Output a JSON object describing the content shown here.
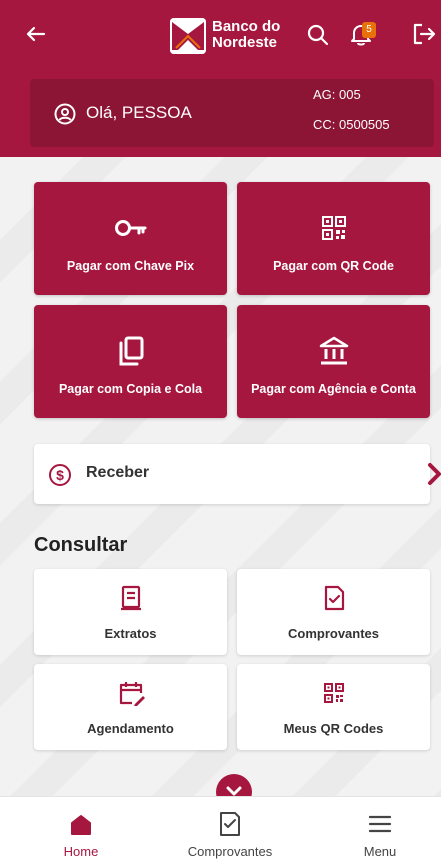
{
  "header": {
    "logo_line1": "Banco do",
    "logo_line2": "Nordeste",
    "notification_count": "5"
  },
  "account": {
    "greeting": "Olá, PESSOA",
    "agency": "AG: 005",
    "account": "CC: 0500505"
  },
  "pix_actions": [
    {
      "label": "Pagar com Chave Pix",
      "icon": "key-icon"
    },
    {
      "label": "Pagar com QR Code",
      "icon": "qr-code-icon"
    },
    {
      "label": "Pagar com Copia e Cola",
      "icon": "copy-icon"
    },
    {
      "label": "Pagar com Agência e Conta",
      "icon": "bank-icon"
    }
  ],
  "receive": {
    "label": "Receber",
    "icon": "dollar-circle-icon"
  },
  "consult": {
    "title": "Consultar",
    "items": [
      {
        "label": "Extratos",
        "icon": "statement-icon"
      },
      {
        "label": "Comprovantes",
        "icon": "receipt-check-icon"
      },
      {
        "label": "Agendamento",
        "icon": "calendar-edit-icon"
      },
      {
        "label": "Meus QR Codes",
        "icon": "qr-code-icon"
      }
    ]
  },
  "bottom_nav": [
    {
      "label": "Home",
      "icon": "home-icon",
      "active": true
    },
    {
      "label": "Comprovantes",
      "icon": "receipt-check-icon",
      "active": false
    },
    {
      "label": "Menu",
      "icon": "menu-icon",
      "active": false
    }
  ],
  "colors": {
    "brand": "#a6173f",
    "brand_dark": "#8c1535",
    "badge": "#e8710a"
  }
}
